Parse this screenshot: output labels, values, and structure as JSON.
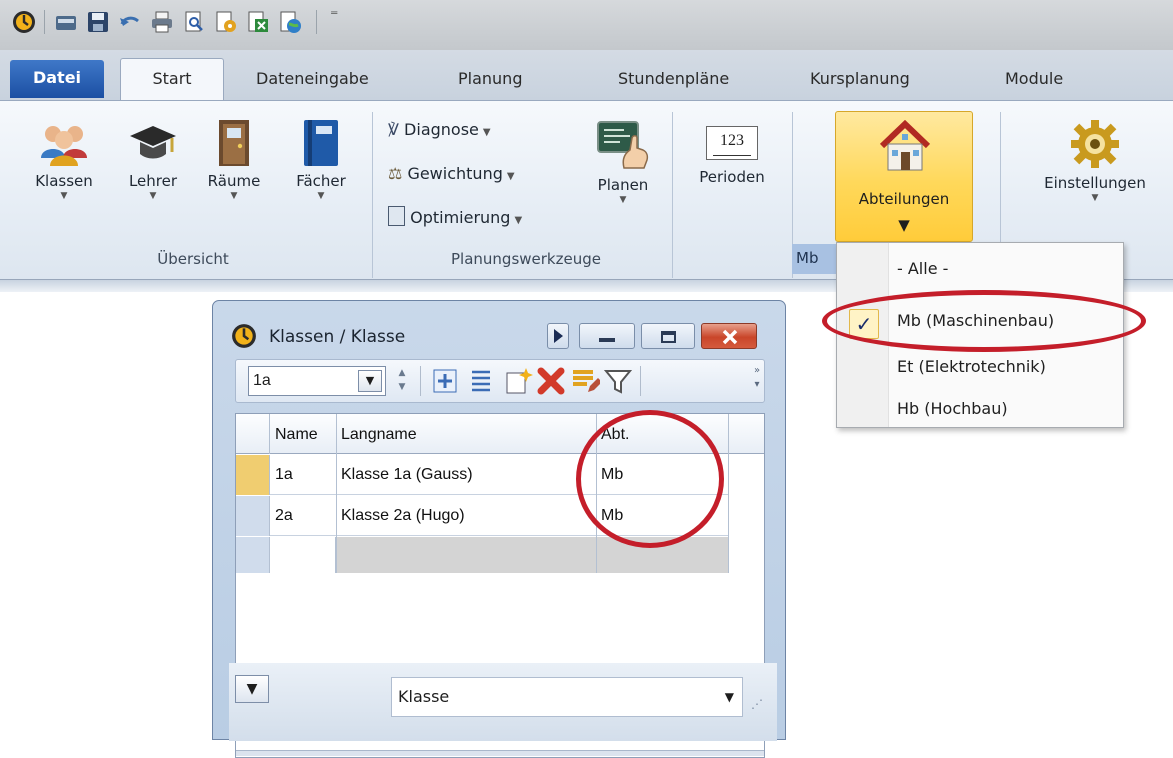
{
  "ribbon": {
    "tabs": [
      "Datei",
      "Start",
      "Dateneingabe",
      "Planung",
      "Stundenpläne",
      "Kursplanung",
      "Module"
    ],
    "buttons": {
      "klassen": "Klassen",
      "lehrer": "Lehrer",
      "raeume": "Räume",
      "faecher": "Fächer",
      "diagnose": "Diagnose",
      "gewichtung": "Gewichtung",
      "optimierung": "Optimierung",
      "planen": "Planen",
      "perioden": "Perioden",
      "abteilungen": "Abteilungen",
      "einstellungen": "Einstellungen"
    },
    "groups": {
      "uebersicht": "Übersicht",
      "planungswerkzeuge": "Planungswerkzeuge"
    },
    "dept_badge": "Mb",
    "perioden_icon_text": "123"
  },
  "dept_menu": {
    "items": [
      "- Alle -",
      "Mb (Maschinenbau)",
      "Et (Elektrotechnik)",
      "Hb (Hochbau)"
    ],
    "checked_index": 1,
    "check_mark": "✓"
  },
  "window": {
    "title": "Klassen / Klasse",
    "search_value": "1a",
    "columns": [
      "Name",
      "Langname",
      "Abt."
    ],
    "rows": [
      {
        "name": "1a",
        "langname": "Klasse 1a (Gauss)",
        "abt": "Mb"
      },
      {
        "name": "2a",
        "langname": "Klasse 2a (Hugo)",
        "abt": "Mb"
      }
    ],
    "footer_select": "Klasse"
  },
  "colors": {
    "highlight_yellow": "#ffd85a",
    "annotation_red": "#c41e2a",
    "file_tab_blue": "#1b4fa3"
  }
}
